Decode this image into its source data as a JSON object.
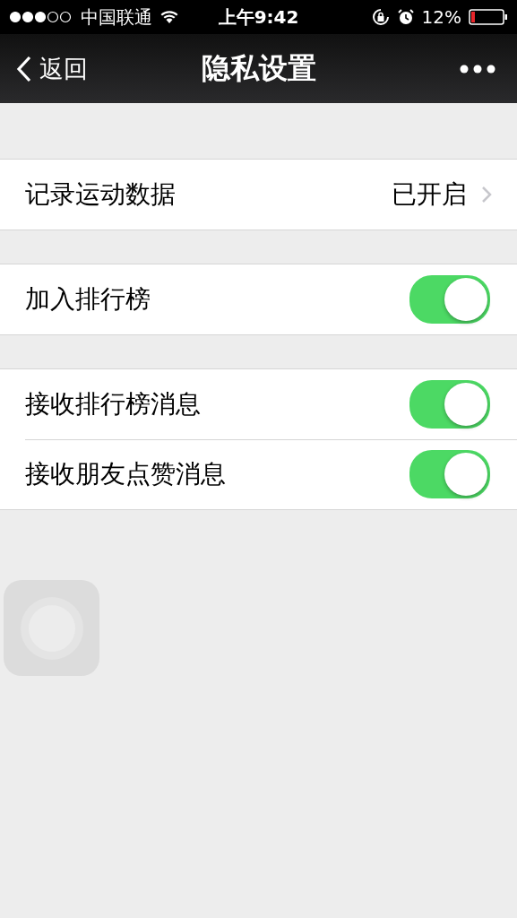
{
  "status_bar": {
    "carrier": "中国联通",
    "time": "上午9:42",
    "battery": "12%"
  },
  "nav_bar": {
    "back": "返回",
    "title": "隐私设置"
  },
  "sections": [
    {
      "rows": [
        {
          "kind": "link",
          "label": "记录运动数据",
          "value": "已开启"
        }
      ]
    },
    {
      "rows": [
        {
          "kind": "toggle",
          "label": "加入排行榜",
          "on": true
        }
      ]
    },
    {
      "rows": [
        {
          "kind": "toggle",
          "label": "接收排行榜消息",
          "on": true
        },
        {
          "kind": "toggle",
          "label": "接收朋友点赞消息",
          "on": true
        }
      ]
    }
  ]
}
